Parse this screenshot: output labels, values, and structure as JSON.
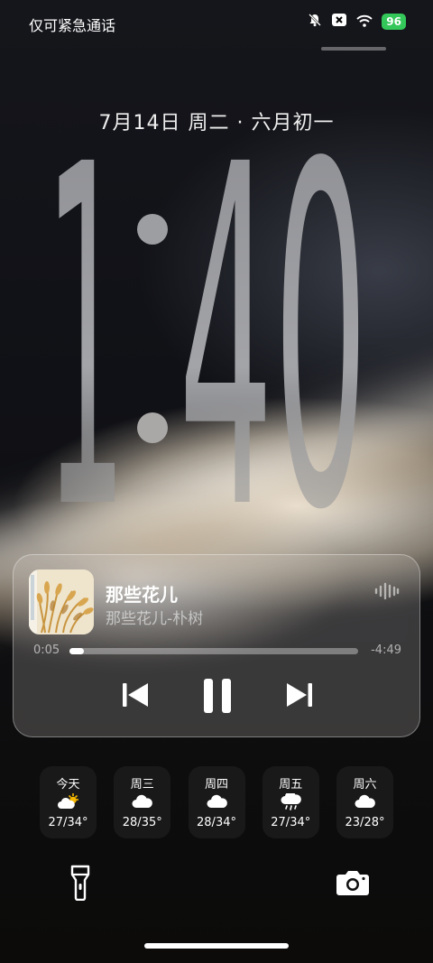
{
  "status_bar": {
    "carrier": "仅可紧急通话",
    "battery": "96"
  },
  "lockscreen": {
    "date": "7月14日 周二 · 六月初一",
    "time_hour": "1",
    "time_minute": "40"
  },
  "media": {
    "title": "那些花儿",
    "subtitle": "那些花儿-朴树",
    "elapsed": "0:05",
    "remaining": "-4:49",
    "progress_fraction": 0.05
  },
  "weather": [
    {
      "day": "今天",
      "icon": "partly-sunny-icon",
      "temp": "27/34°"
    },
    {
      "day": "周三",
      "icon": "cloud-icon",
      "temp": "28/35°"
    },
    {
      "day": "周四",
      "icon": "cloud-icon",
      "temp": "28/34°"
    },
    {
      "day": "周五",
      "icon": "rain-cloud-icon",
      "temp": "27/34°"
    },
    {
      "day": "周六",
      "icon": "cloud-icon",
      "temp": "23/28°"
    }
  ],
  "colors": {
    "battery_green": "#34c759"
  }
}
